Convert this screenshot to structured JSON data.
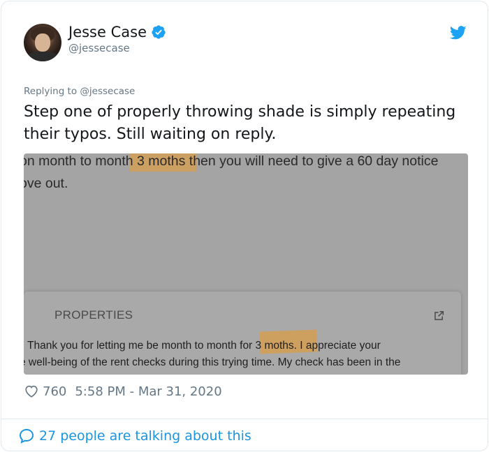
{
  "author": {
    "display_name": "Jesse Case",
    "handle": "@jessecase",
    "verified": true
  },
  "tweet": {
    "replying_to": "Replying to @jessecase",
    "text": "Step one of properly throwing shade is simply repeating their typos. Still waiting on reply."
  },
  "media": {
    "line1": "on month to month 3 moths then you will need to give a 60 day notice",
    "line2": "ove out.",
    "panel_title": "PROPERTIES",
    "panel_line1": "Thank you for letting me be month to month for 3 moths. I appreciate your",
    "panel_line2": "e well-being of the rent checks during this trying time. My check has been in the",
    "highlight_color": "#d99e4c"
  },
  "meta": {
    "likes": "760",
    "timestamp": "5:58 PM - Mar 31, 2020"
  },
  "footer": {
    "talking": "27 people are talking about this"
  },
  "colors": {
    "accent": "#1da1f2",
    "link": "#1b95e0",
    "muted": "#657786",
    "text": "#14171a"
  },
  "icons": [
    "verified-badge-icon",
    "twitter-bird-icon",
    "heart-icon",
    "speech-bubble-icon",
    "external-link-icon"
  ]
}
